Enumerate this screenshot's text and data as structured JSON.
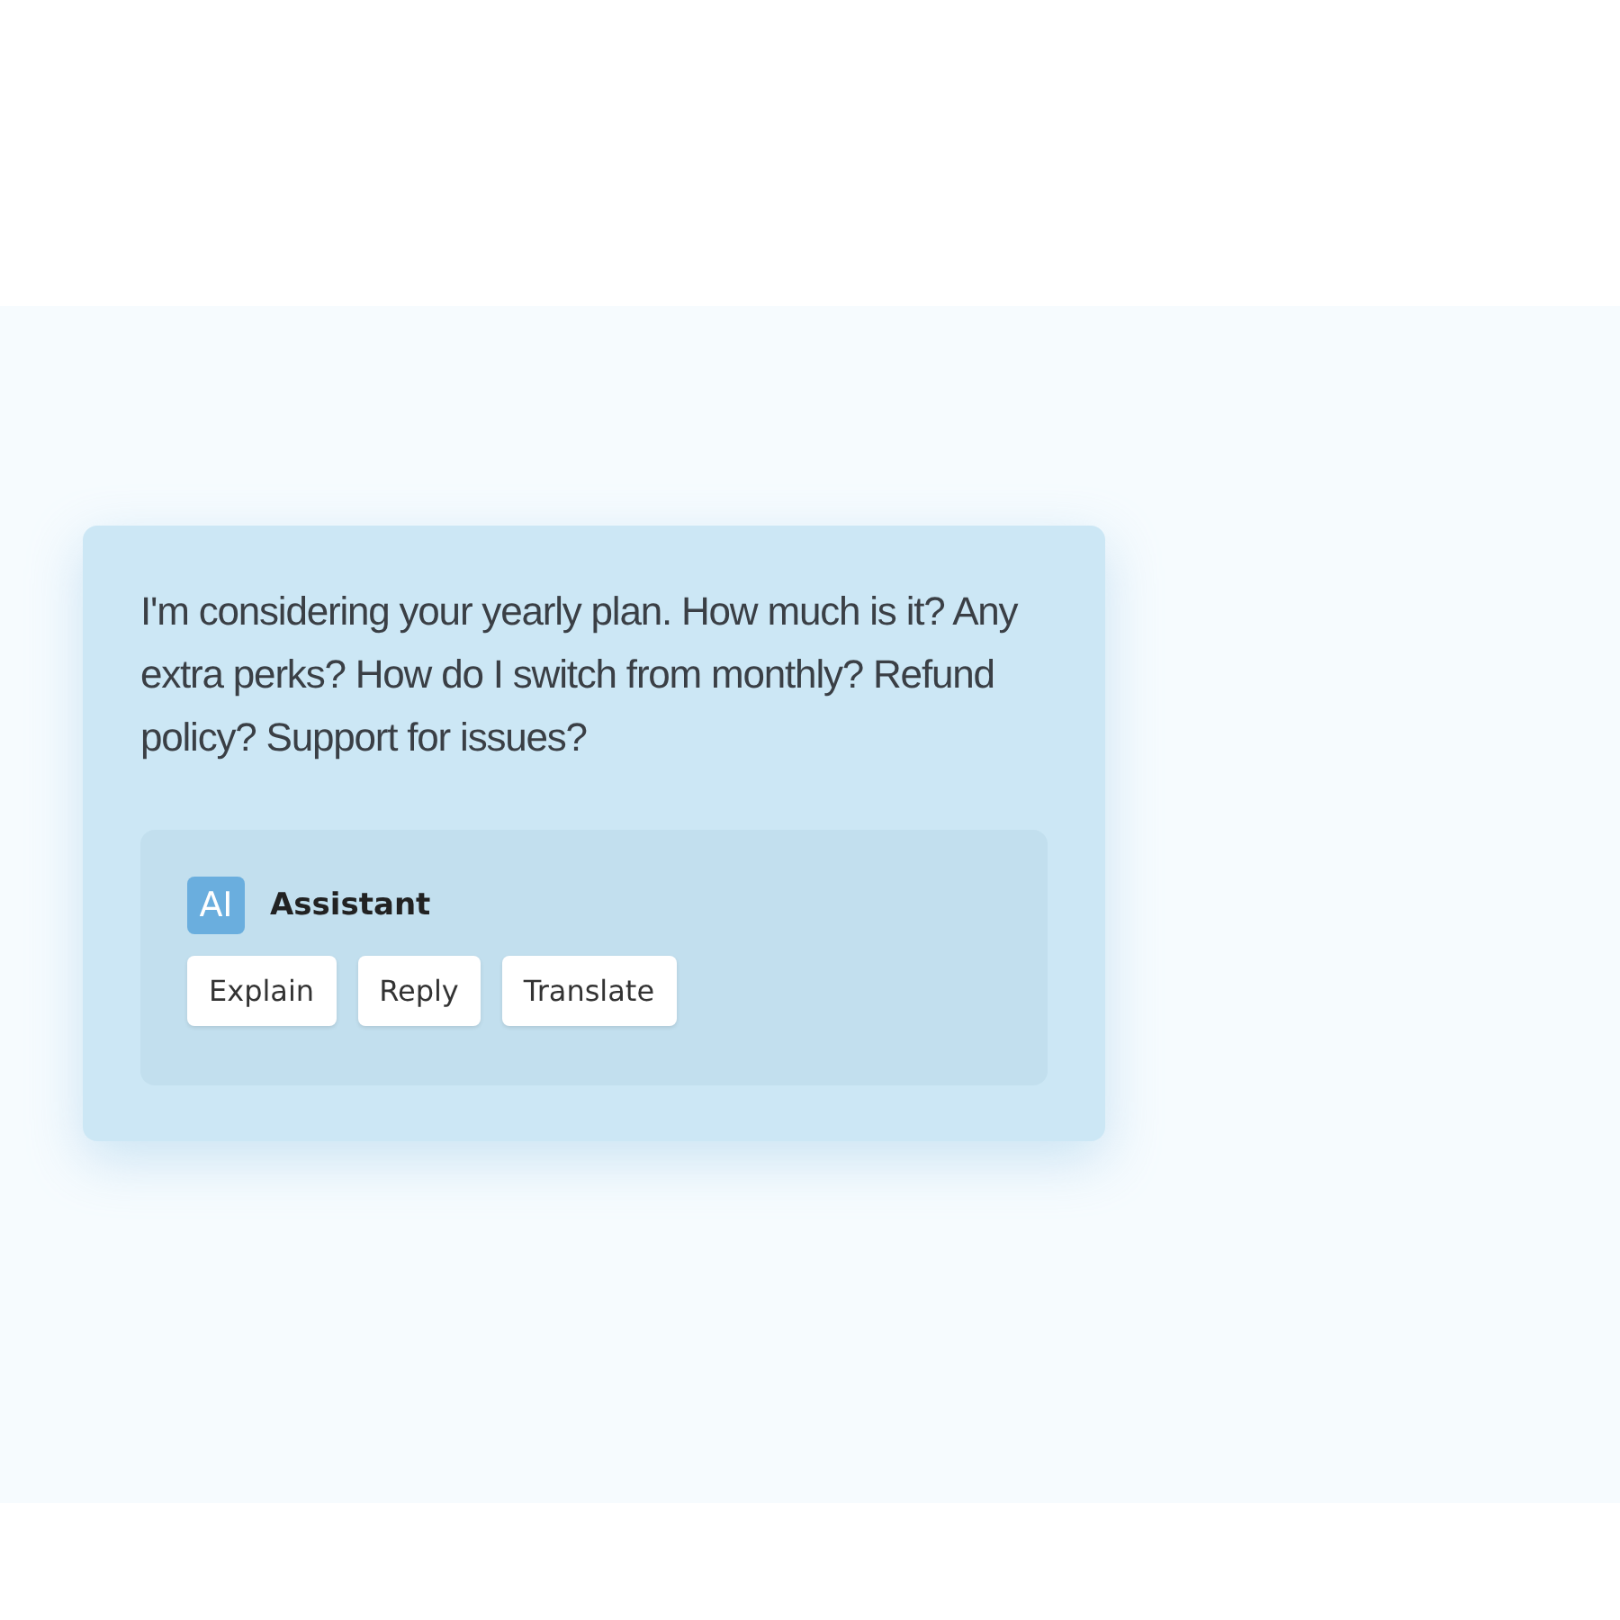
{
  "message": {
    "text": "I'm considering your yearly plan. How much is it? Any extra perks? How do I switch from monthly? Refund policy? Support for issues?"
  },
  "assistant": {
    "badge": "AI",
    "title": "Assistant",
    "actions": [
      "Explain",
      "Reply",
      "Translate"
    ]
  }
}
